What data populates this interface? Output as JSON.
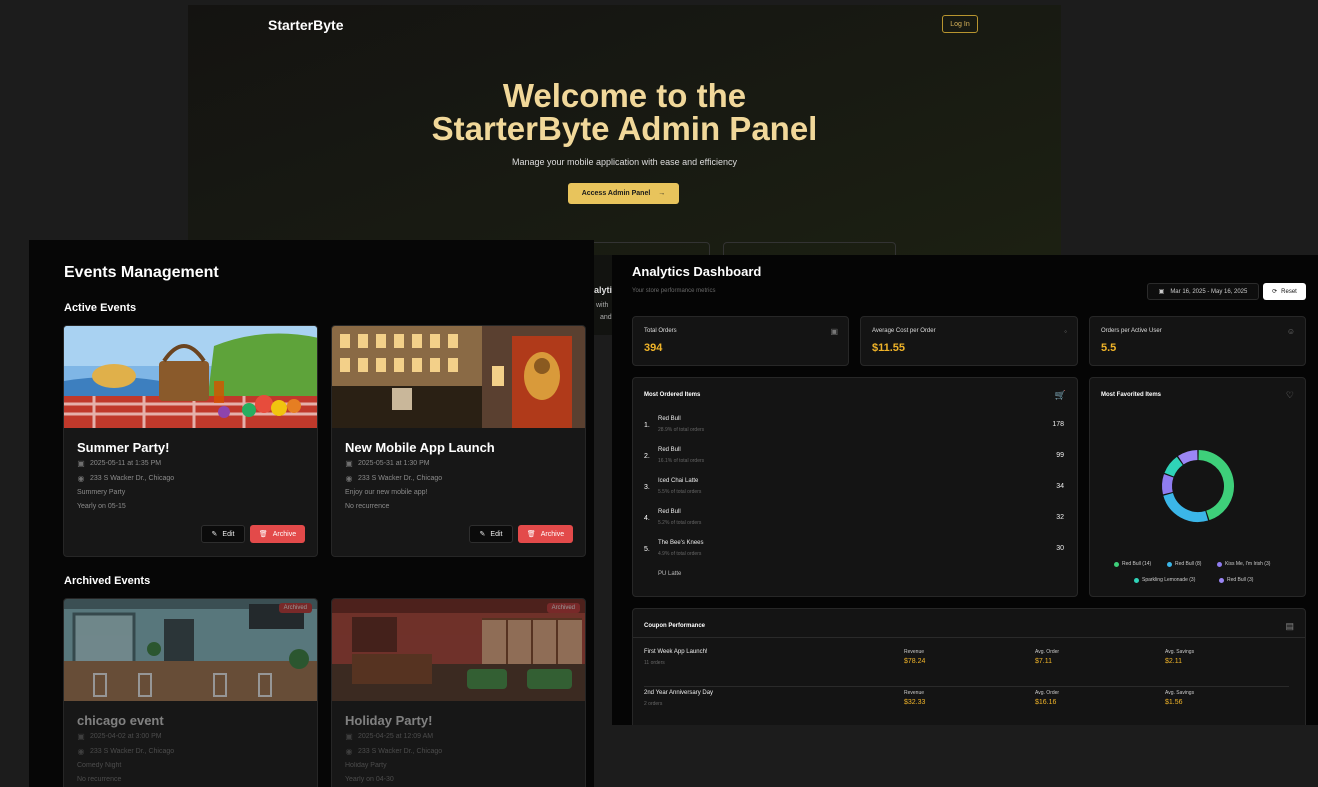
{
  "landing": {
    "brand": "StarterByte",
    "login": "Log In",
    "title_line1": "Welcome to the",
    "title_line2": "StarterByte Admin Panel",
    "subtitle": "Manage your mobile application with ease and efficiency",
    "cta": "Access Admin Panel",
    "cta_icon": "arrow-right-icon",
    "peek_text_1": "alytic",
    "peek_text_2": "with",
    "peek_text_3": "and"
  },
  "events": {
    "title": "Events Management",
    "active_heading": "Active Events",
    "archived_heading": "Archived Events",
    "edit_label": "Edit",
    "archive_label": "Archive",
    "archived_badge": "Archived",
    "active": [
      {
        "title": "Summer Party!",
        "datetime": "2025-05-11 at 1:35 PM",
        "location": "233 S Wacker Dr., Chicago",
        "description": "Summery Party",
        "recurrence": "Yearly on 05-15"
      },
      {
        "title": "New Mobile App Launch",
        "datetime": "2025-05-31 at 1:30 PM",
        "location": "233 S Wacker Dr., Chicago",
        "description": "Enjoy our new mobile app!",
        "recurrence": "No recurrence"
      }
    ],
    "archived": [
      {
        "title": "chicago event",
        "datetime": "2025-04-02 at 3:00 PM",
        "location": "233 S Wacker Dr., Chicago",
        "description": "Comedy Night",
        "recurrence": "No recurrence"
      },
      {
        "title": "Holiday Party!",
        "datetime": "2025-04-25 at 12:09 AM",
        "location": "233 S Wacker Dr., Chicago",
        "description": "Holiday Party",
        "recurrence": "Yearly on 04-30"
      }
    ]
  },
  "analytics": {
    "title": "Analytics Dashboard",
    "subtitle": "Your store performance metrics",
    "date_range": "Mar 16, 2025 - May 16, 2025",
    "reset": "Reset",
    "stats": [
      {
        "label": "Total Orders",
        "value": "394",
        "icon": "calendar-icon"
      },
      {
        "label": "Average Cost per Order",
        "value": "$11.55",
        "icon": "dollar-icon"
      },
      {
        "label": "Orders per Active User",
        "value": "5.5",
        "icon": "users-icon"
      }
    ],
    "most_ordered": {
      "title": "Most Ordered Items",
      "items": [
        {
          "rank": "1.",
          "name": "Red Bull",
          "pct": "28.9% of total orders",
          "count": "178"
        },
        {
          "rank": "2.",
          "name": "Red Bull",
          "pct": "16.1% of total orders",
          "count": "99"
        },
        {
          "rank": "3.",
          "name": "Iced Chai Latte",
          "pct": "5.5% of total orders",
          "count": "34"
        },
        {
          "rank": "4.",
          "name": "Red Bull",
          "pct": "5.2% of total orders",
          "count": "32"
        },
        {
          "rank": "5.",
          "name": "The Bee's Knees",
          "pct": "4.9% of total orders",
          "count": "30"
        }
      ],
      "cut_item": "PU Latte"
    },
    "most_favorited": {
      "title": "Most Favorited Items",
      "segments": [
        {
          "label": "Red Bull (14)",
          "value": 14,
          "color": "#3ecf7a"
        },
        {
          "label": "Red Bull (8)",
          "value": 8,
          "color": "#3bb6e8"
        },
        {
          "label": "Kiss Me, I'm Irish (3)",
          "value": 3,
          "color": "#8f7cf0"
        },
        {
          "label": "Sparkling Lemonade (3)",
          "value": 3,
          "color": "#2fd3b8"
        },
        {
          "label": "Red Bull (3)",
          "value": 3,
          "color": "#9b86f5"
        }
      ]
    },
    "coupons": {
      "title": "Coupon Performance",
      "revenue_label": "Revenue",
      "avg_order_label": "Avg. Order",
      "avg_savings_label": "Avg. Savings",
      "rows": [
        {
          "name": "First Week App Launch!",
          "orders": "11 orders",
          "revenue": "$78.24",
          "avg_order": "$7.11",
          "avg_savings": "$2.11"
        },
        {
          "name": "2nd Year Anniversary Day",
          "orders": "2 orders",
          "revenue": "$32.33",
          "avg_order": "$16.16",
          "avg_savings": "$1.56"
        }
      ]
    }
  }
}
